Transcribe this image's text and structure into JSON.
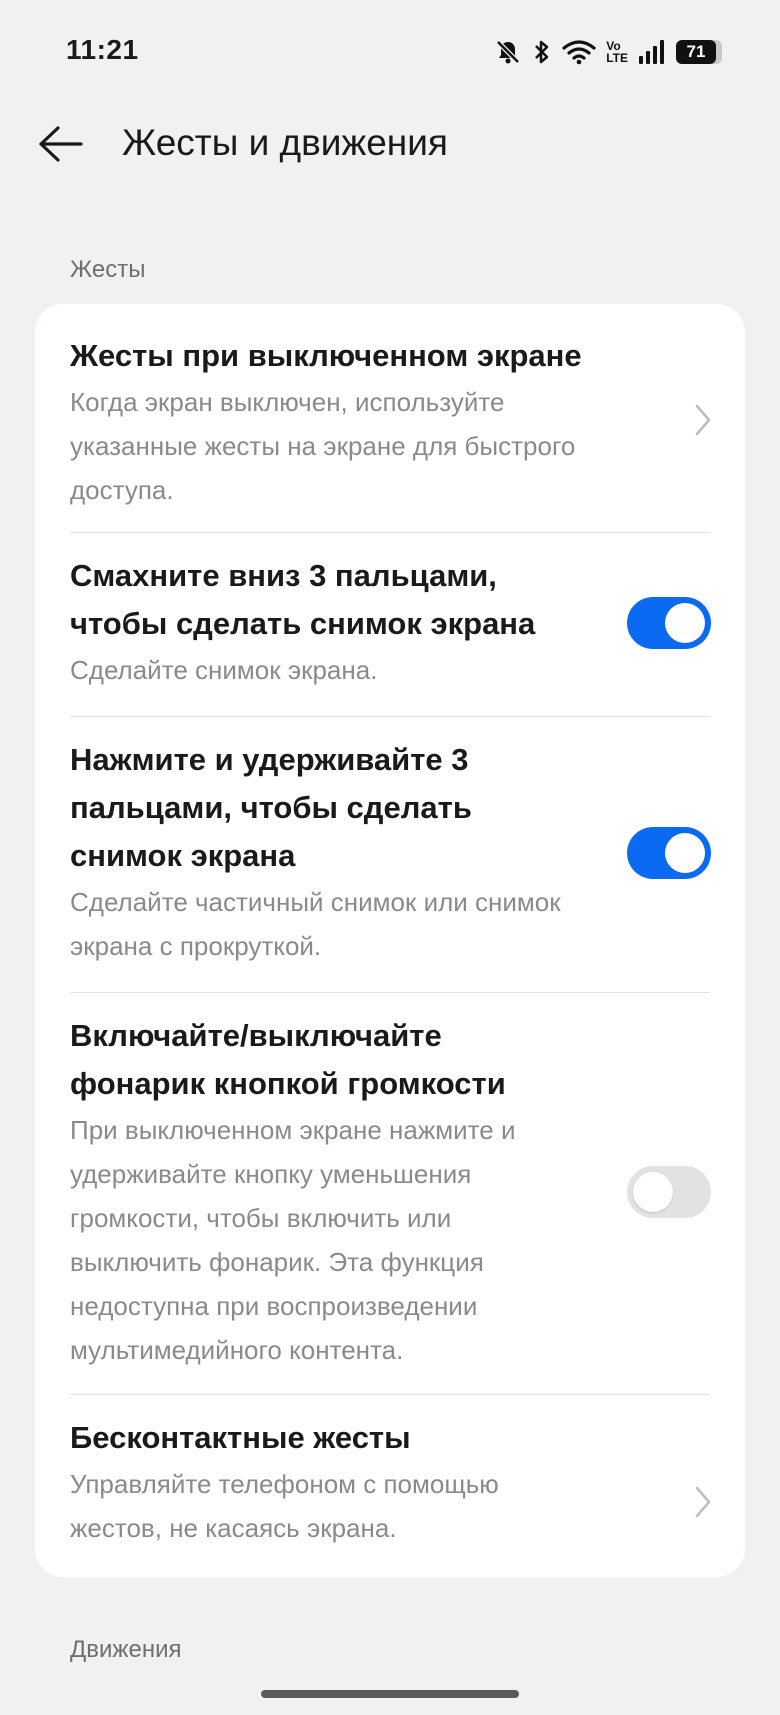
{
  "status_bar": {
    "time": "11:21",
    "battery_level": "71",
    "icons": [
      "mute-bell-icon",
      "bluetooth-icon",
      "wifi-icon",
      "volte-icon",
      "signal-icon",
      "battery-icon"
    ],
    "volte_label_top": "Vo",
    "volte_label_bottom": "LTE"
  },
  "app_bar": {
    "title": "Жесты и движения",
    "back_icon": "arrow-left-icon"
  },
  "sections": {
    "gestures_label": "Жесты",
    "motions_label": "Движения"
  },
  "items": [
    {
      "title": "Жесты при выключенном экране",
      "description": "Когда экран выключен, используйте указанные жесты на экране для быстрого доступа.",
      "control": "chevron"
    },
    {
      "title": "Смахните вниз 3 пальцами, чтобы сделать снимок экрана",
      "description": "Сделайте снимок экрана.",
      "control": "toggle",
      "enabled": true
    },
    {
      "title": "Нажмите и удерживайте 3 пальцами, чтобы сделать снимок экрана",
      "description": "Сделайте частичный снимок или снимок экрана с прокруткой.",
      "control": "toggle",
      "enabled": true
    },
    {
      "title": "Включайте/выключайте фонарик кнопкой громкости",
      "description": "При выключенном экране нажмите и удерживайте кнопку уменьшения громкости, чтобы включить или выключить фонарик. Эта функция недоступна при воспроизведении мультимедийного контента.",
      "control": "toggle",
      "enabled": false
    },
    {
      "title": "Бесконтактные жесты",
      "description": "Управляйте телефоном с помощью жестов, не касаясь экрана.",
      "control": "chevron"
    }
  ],
  "colors": {
    "background": "#f0f1f3",
    "card": "#ffffff",
    "accent": "#0a6bf2",
    "toggle_off": "#e2e2e2",
    "secondary_text": "#8a8a8a"
  }
}
